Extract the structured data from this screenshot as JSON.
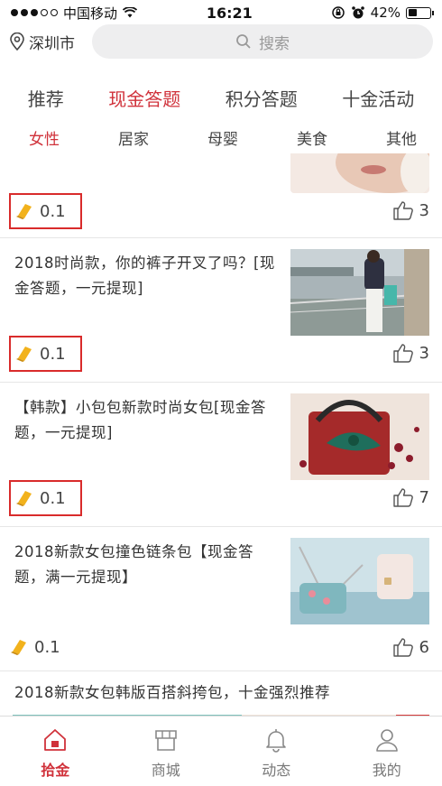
{
  "status_bar": {
    "carrier": "中国移动",
    "time": "16:21",
    "battery": "42%",
    "battery_level": 0.42
  },
  "header": {
    "location": "深圳市",
    "search_placeholder": "搜索"
  },
  "tabs": [
    {
      "label": "推荐",
      "active": false
    },
    {
      "label": "现金答题",
      "active": true
    },
    {
      "label": "积分答题",
      "active": false
    },
    {
      "label": "十金活动",
      "active": false
    }
  ],
  "subtabs": [
    {
      "label": "女性",
      "active": true
    },
    {
      "label": "居家",
      "active": false
    },
    {
      "label": "母婴",
      "active": false
    },
    {
      "label": "美食",
      "active": false
    },
    {
      "label": "其他",
      "active": false
    }
  ],
  "items": [
    {
      "title": "",
      "reward": "0.1",
      "likes": "3"
    },
    {
      "title": "2018时尚款，你的裤子开叉了吗？[现金答题，一元提现]",
      "reward": "0.1",
      "likes": "3"
    },
    {
      "title": "【韩款】小包包新款时尚女包[现金答题，一元提现]",
      "reward": "0.1",
      "likes": "7"
    },
    {
      "title": "2018新款女包撞色链条包【现金答题，满一元提现】",
      "reward": "0.1",
      "likes": "6"
    },
    {
      "title": "2018新款女包韩版百搭斜挎包，十金强烈推荐",
      "reward": "",
      "likes": ""
    }
  ],
  "bottom_nav": [
    {
      "label": "拾金",
      "icon": "home-icon",
      "active": true
    },
    {
      "label": "商城",
      "icon": "shop-icon",
      "active": false
    },
    {
      "label": "动态",
      "icon": "bell-icon",
      "active": false
    },
    {
      "label": "我的",
      "icon": "person-icon",
      "active": false
    }
  ],
  "colors": {
    "accent": "#d0313a",
    "highlight_box": "#d92b2b",
    "coin": "#f2b21c"
  }
}
